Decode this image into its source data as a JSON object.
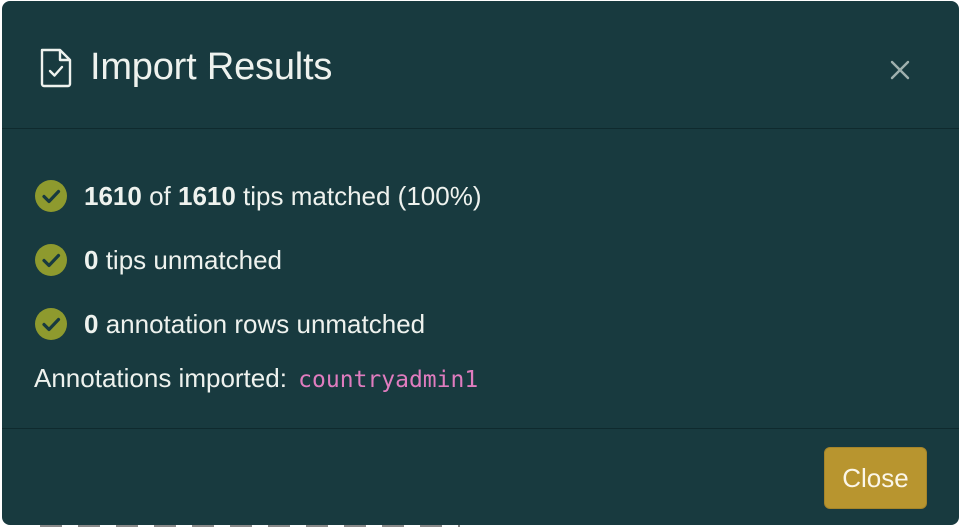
{
  "modal": {
    "title": "Import Results",
    "title_icon": "file-check-icon",
    "close_icon": "close-icon",
    "results": [
      {
        "count": "1610",
        "middle": " of ",
        "total": "1610",
        "text": " tips matched (100%)",
        "icon": "check-circle-icon"
      },
      {
        "count": "0",
        "text": " tips unmatched",
        "icon": "check-circle-icon"
      },
      {
        "count": "0",
        "text": " annotation rows unmatched",
        "icon": "check-circle-icon"
      }
    ],
    "imported_label": "Annotations imported:",
    "imported_user": "countryadmin1",
    "close_label": "Close"
  },
  "colors": {
    "modal_bg": "#183a3f",
    "check_fill": "#8e9a2e",
    "button_bg": "#b8952f",
    "code_pink": "#e07cbf"
  }
}
